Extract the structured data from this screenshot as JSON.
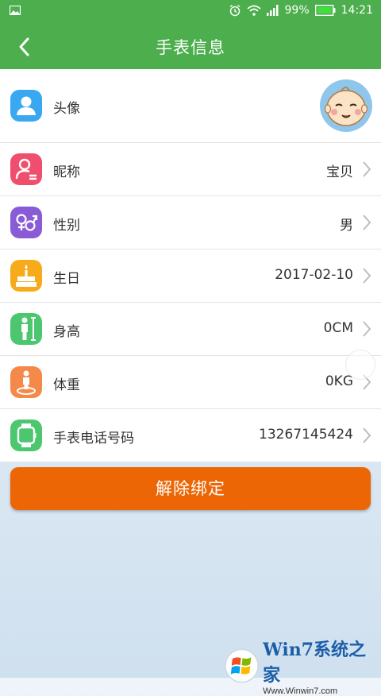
{
  "status_bar": {
    "battery_text": "99%",
    "time": "14:21"
  },
  "header": {
    "title": "手表信息"
  },
  "rows": [
    {
      "label": "头像",
      "value": "",
      "icon": "avatar-icon",
      "color": "#3aa8f0"
    },
    {
      "label": "昵称",
      "value": "宝贝",
      "icon": "nickname-icon",
      "color": "#ef4e6c"
    },
    {
      "label": "性别",
      "value": "男",
      "icon": "gender-icon",
      "color": "#8a5bd6"
    },
    {
      "label": "生日",
      "value": "2017-02-10",
      "icon": "birthday-cake-icon",
      "color": "#f7ab1a"
    },
    {
      "label": "身高",
      "value": "0CM",
      "icon": "height-icon",
      "color": "#4cc76f"
    },
    {
      "label": "体重",
      "value": "0KG",
      "icon": "weight-icon",
      "color": "#f4894a"
    },
    {
      "label": "手表电话号码",
      "value": "13267145424",
      "icon": "watch-icon",
      "color": "#4cc76f"
    }
  ],
  "actions": {
    "unbind_label": "解除绑定"
  },
  "watermark": {
    "name": "Win7系统之家",
    "url": "Www.Winwin7.com"
  },
  "colors": {
    "primary_green": "#4cae4c",
    "unbind_orange": "#ec6605"
  }
}
